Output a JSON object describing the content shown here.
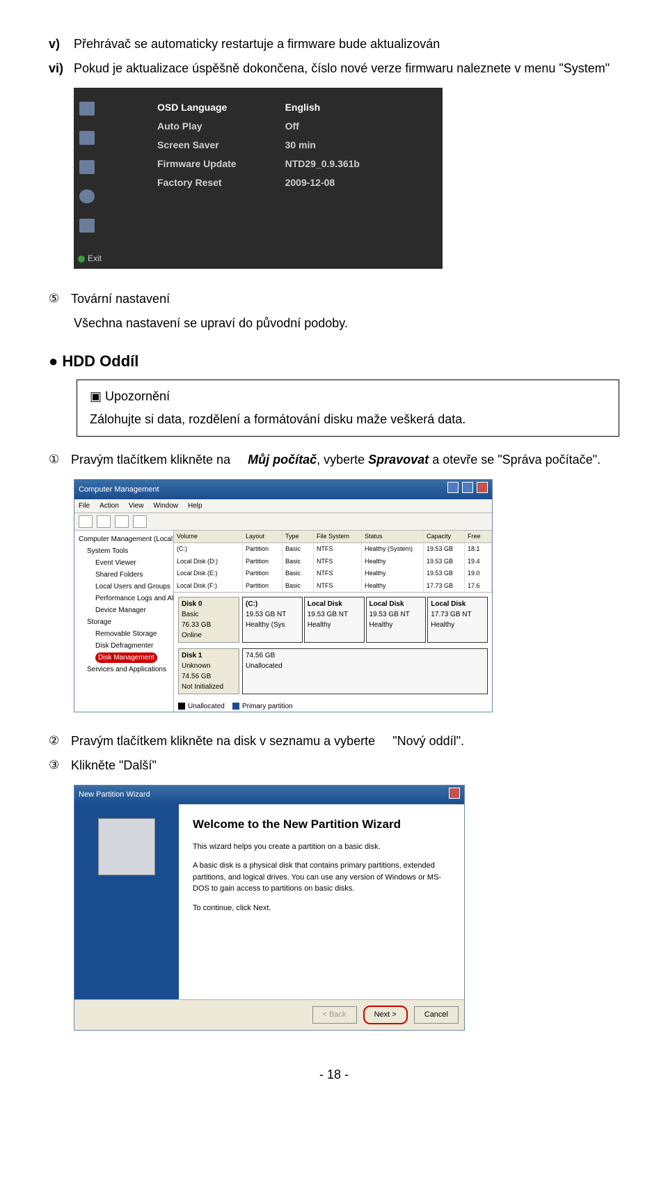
{
  "item_v": {
    "marker": "v)",
    "text": "Přehrávač se automaticky restartuje a firmware bude aktualizován"
  },
  "item_vi": {
    "marker": "vi)",
    "text": "Pokud je aktualizace úspěšně dokončena, číslo nové verze firmwaru naleznete v menu \"System\""
  },
  "osd": {
    "left": [
      "OSD Language",
      "Auto Play",
      "Screen Saver",
      "Firmware Update",
      "Factory Reset"
    ],
    "right": [
      "English",
      "Off",
      "30 min",
      "NTD29_0.9.361b",
      "2009-12-08"
    ],
    "exit": "Exit"
  },
  "item_5": {
    "marker": "⑤",
    "title": "Tovární nastavení",
    "text": "Všechna nastavení se upraví do původní podoby."
  },
  "hdd_heading": "● HDD Oddíl",
  "notice": {
    "title": "▣ Upozornění",
    "text": "Zálohujte si data, rozdělení a formátování disku maže veškerá data."
  },
  "item_1": {
    "marker": "①",
    "pre": "Pravým tlačítkem klikněte na",
    "bold": "Můj počítač",
    "mid": ", vyberte ",
    "bold2": "Spravovat",
    "post": " a otevře se \"Správa počítače\"."
  },
  "cm": {
    "title": "Computer Management",
    "menu": [
      "File",
      "Action",
      "View",
      "Window",
      "Help"
    ],
    "tree": {
      "root": "Computer Management (Local)",
      "systools": "System Tools",
      "children": [
        "Event Viewer",
        "Shared Folders",
        "Local Users and Groups",
        "Performance Logs and Alerts",
        "Device Manager"
      ],
      "storage": "Storage",
      "storage_children": [
        "Removable Storage",
        "Disk Defragmenter"
      ],
      "diskmgmt": "Disk Management",
      "services": "Services and Applications"
    },
    "headers": [
      "Volume",
      "Layout",
      "Type",
      "File System",
      "Status",
      "Capacity",
      "Free"
    ],
    "rows": [
      [
        "(C:)",
        "Partition",
        "Basic",
        "NTFS",
        "Healthy (System)",
        "19.53 GB",
        "18.1"
      ],
      [
        "Local Disk (D:)",
        "Partition",
        "Basic",
        "NTFS",
        "Healthy",
        "19.53 GB",
        "19.4"
      ],
      [
        "Local Disk (E:)",
        "Partition",
        "Basic",
        "NTFS",
        "Healthy",
        "19.53 GB",
        "19.0"
      ],
      [
        "Local Disk (F:)",
        "Partition",
        "Basic",
        "NTFS",
        "Healthy",
        "17.73 GB",
        "17.6"
      ]
    ],
    "disk0": {
      "name": "Disk 0",
      "type": "Basic",
      "size": "76.33 GB",
      "status": "Online",
      "parts": [
        {
          "name": "(C:)",
          "size": "19.53 GB NT",
          "status": "Healthy (Sys"
        },
        {
          "name": "Local Disk",
          "size": "19.53 GB NT",
          "status": "Healthy"
        },
        {
          "name": "Local Disk",
          "size": "19.53 GB NT",
          "status": "Healthy"
        },
        {
          "name": "Local Disk",
          "size": "17.73 GB NT",
          "status": "Healthy"
        }
      ]
    },
    "disk1": {
      "name": "Disk 1",
      "type": "Unknown",
      "size": "74.56 GB",
      "status": "Not Initialized",
      "part": {
        "size": "74.56 GB",
        "status": "Unallocated"
      }
    },
    "legend": {
      "unalloc": "Unallocated",
      "primary": "Primary partition"
    }
  },
  "item_2": {
    "marker": "②",
    "text": "Pravým tlačítkem klikněte na disk v seznamu a vyberte",
    "quoted": "\"Nový oddíl\"."
  },
  "item_3": {
    "marker": "③",
    "text": "Klikněte \"Další\""
  },
  "wizard": {
    "titlebar": "New Partition Wizard",
    "heading": "Welcome to the New Partition Wizard",
    "p1": "This wizard helps you create a partition on a basic disk.",
    "p2": "A basic disk is a physical disk that contains primary partitions, extended partitions, and logical drives. You can use any version of Windows or MS-DOS to gain access to partitions on basic disks.",
    "p3": "To continue, click Next.",
    "back": "< Back",
    "next": "Next >",
    "cancel": "Cancel"
  },
  "page_number": "- 18 -"
}
